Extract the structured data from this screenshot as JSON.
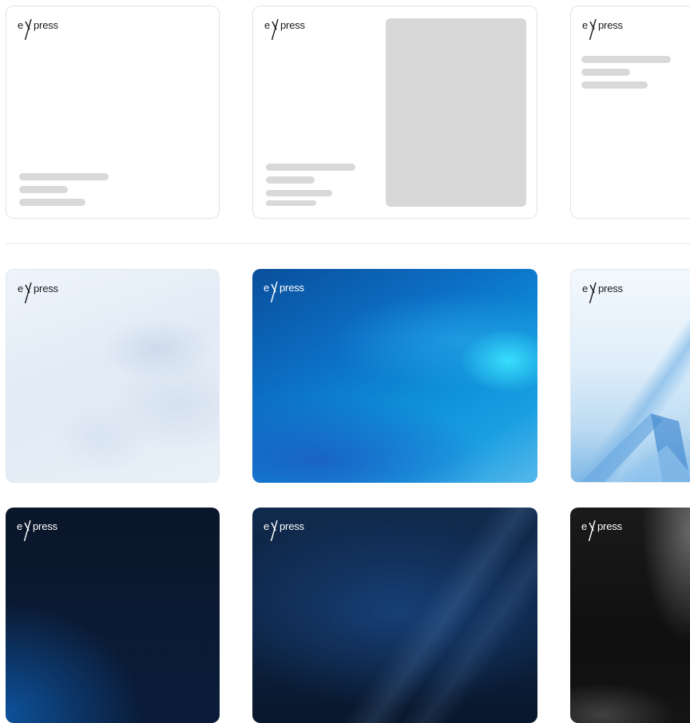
{
  "brand": {
    "logo_text": "press",
    "logo_letter": "e"
  },
  "layout_templates": [
    {
      "name": "layout-text-bottom-left"
    },
    {
      "name": "layout-text-with-image"
    },
    {
      "name": "layout-text-top"
    }
  ],
  "background_templates": [
    {
      "name": "background-light-blue"
    },
    {
      "name": "background-bright-blue"
    },
    {
      "name": "background-crystal"
    },
    {
      "name": "background-dark-navy"
    },
    {
      "name": "background-navy-rays"
    },
    {
      "name": "background-black"
    }
  ],
  "colors": {
    "placeholder_bar": "#d9d9d9",
    "placeholder_image": "#d8d8d8",
    "card_border": "#e4e4e4"
  }
}
